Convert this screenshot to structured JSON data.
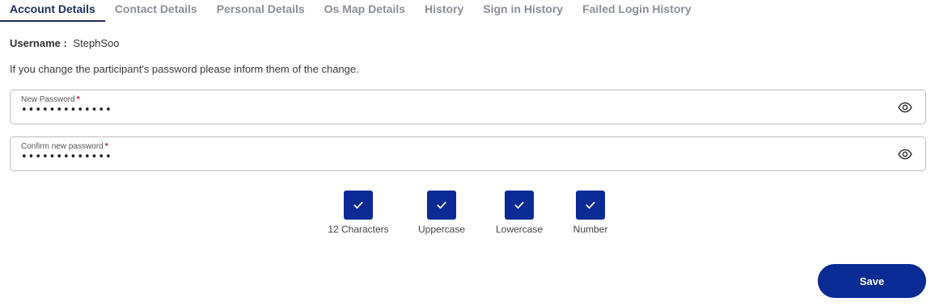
{
  "tabs": [
    {
      "label": "Account Details",
      "active": true
    },
    {
      "label": "Contact Details",
      "active": false
    },
    {
      "label": "Personal Details",
      "active": false
    },
    {
      "label": "Os Map Details",
      "active": false
    },
    {
      "label": "History",
      "active": false
    },
    {
      "label": "Sign in History",
      "active": false
    },
    {
      "label": "Failed Login History",
      "active": false
    }
  ],
  "account": {
    "username_label": "Username :",
    "username_value": "StephSoo",
    "info": "If you change the participant's password please inform them of the change."
  },
  "fields": {
    "new_password": {
      "label": "New Password",
      "required_mark": "*",
      "value": "•••••••••••••",
      "icon": "eye-icon"
    },
    "confirm_password": {
      "label": "Confirm new password",
      "required_mark": "*",
      "value": "•••••••••••••",
      "icon": "eye-icon"
    }
  },
  "requirements": [
    {
      "label": "12 Characters",
      "checked": true
    },
    {
      "label": "Uppercase",
      "checked": true
    },
    {
      "label": "Lowercase",
      "checked": true
    },
    {
      "label": "Number",
      "checked": true
    }
  ],
  "actions": {
    "save_label": "Save"
  },
  "colors": {
    "primary": "#0a2a94",
    "tab_active": "#1d2e5b",
    "tab_inactive": "#8a8f98",
    "required": "#c8102e"
  }
}
